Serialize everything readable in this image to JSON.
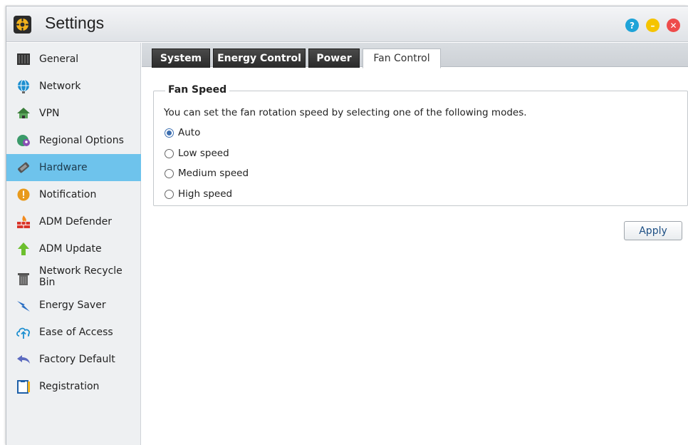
{
  "window": {
    "title": "Settings"
  },
  "title_buttons": {
    "help": "?",
    "minimize": "–",
    "close": "✕"
  },
  "sidebar": {
    "items": [
      {
        "label": "General",
        "icon": "general-icon"
      },
      {
        "label": "Network",
        "icon": "globe-icon"
      },
      {
        "label": "VPN",
        "icon": "vpn-icon"
      },
      {
        "label": "Regional Options",
        "icon": "regional-icon"
      },
      {
        "label": "Hardware",
        "icon": "hardware-icon",
        "active": true
      },
      {
        "label": "Notification",
        "icon": "alert-icon"
      },
      {
        "label": "ADM Defender",
        "icon": "firewall-icon"
      },
      {
        "label": "ADM Update",
        "icon": "up-arrow-icon"
      },
      {
        "label": "Network Recycle Bin",
        "icon": "trash-icon"
      },
      {
        "label": "Energy Saver",
        "icon": "lightning-icon"
      },
      {
        "label": "Ease of Access",
        "icon": "cloud-upload-icon"
      },
      {
        "label": "Factory Default",
        "icon": "undo-icon"
      },
      {
        "label": "Registration",
        "icon": "clipboard-icon"
      }
    ]
  },
  "tabs": [
    {
      "label": "System"
    },
    {
      "label": "Energy Control"
    },
    {
      "label": "Power"
    },
    {
      "label": "Fan Control",
      "active": true
    }
  ],
  "fan_speed": {
    "legend": "Fan Speed",
    "description": "You can set the fan rotation speed by selecting one of the following modes.",
    "options": [
      {
        "label": "Auto",
        "selected": true
      },
      {
        "label": "Low speed"
      },
      {
        "label": "Medium speed"
      },
      {
        "label": "High speed"
      }
    ]
  },
  "actions": {
    "apply_label": "Apply"
  },
  "colors": {
    "active_sidebar": "#6ec3ec",
    "tab_dark": "#2f2f2f",
    "help_button": "#1ea3d8",
    "minimize_button": "#f5c400",
    "close_button": "#ee4b4b"
  }
}
